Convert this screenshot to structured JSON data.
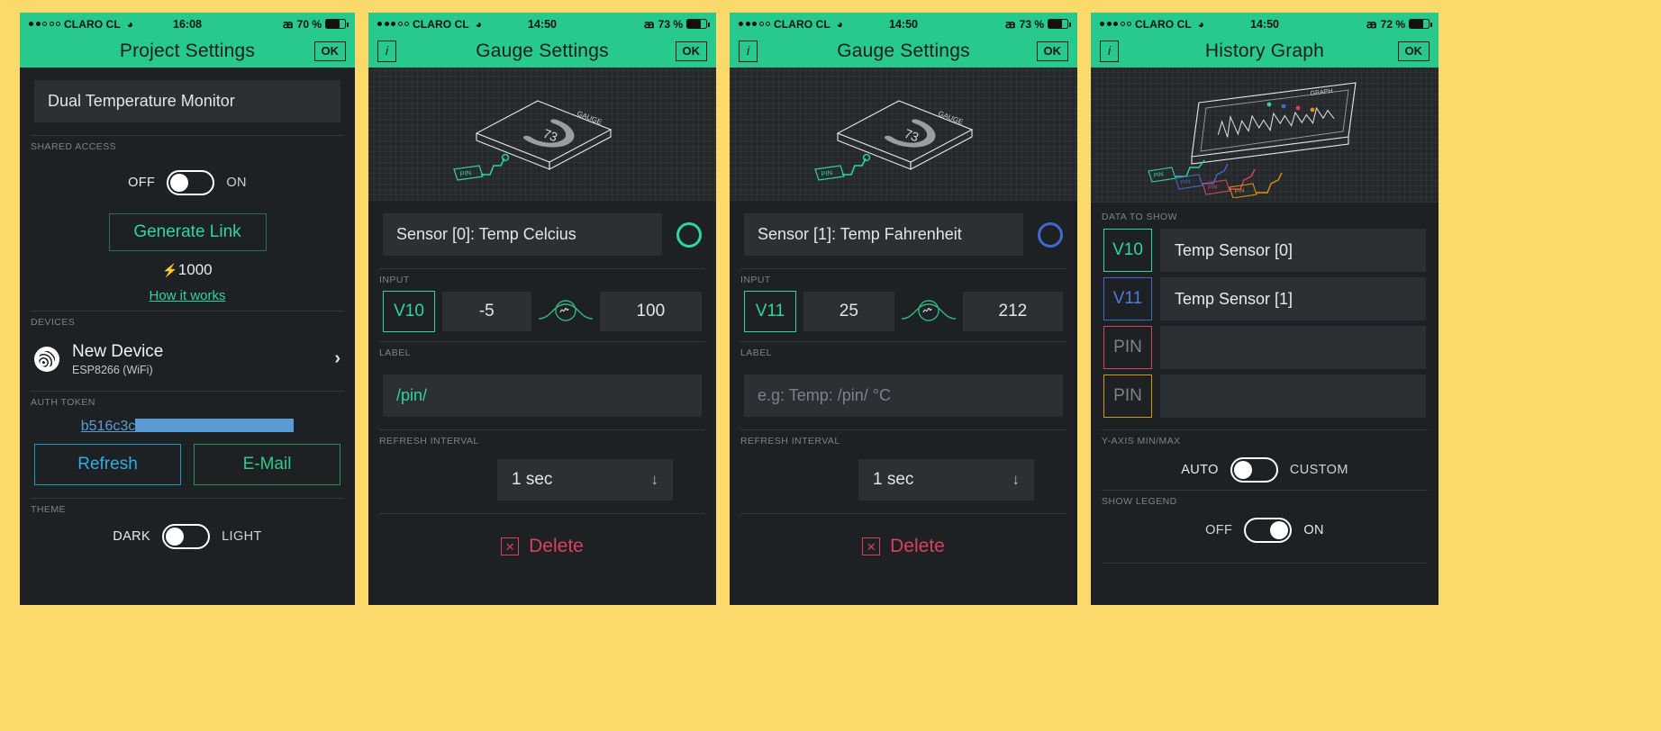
{
  "theme": {
    "accent_green": "#27C98C",
    "page_bg": "#FBD96B",
    "panel_bg": "#1E2124",
    "field_bg": "#2C2F33",
    "blue": "#4169C9",
    "red": "#D8415E",
    "amber": "#D99212",
    "link_blue": "#5B9BD5"
  },
  "panels": [
    {
      "id": "project-settings",
      "status": {
        "carrier": "CLARO CL",
        "signal_filled": 2,
        "signal_total": 5,
        "wifi": "wifi-icon",
        "time": "16:08",
        "bluetooth": "bluetooth-icon",
        "battery_text": "70 %",
        "battery_pct": 70
      },
      "nav": {
        "title": "Project Settings",
        "right_button": "OK",
        "left_button": null
      },
      "project_name": "Dual Temperature Monitor",
      "shared_access": {
        "label": "SHARED ACCESS",
        "off_label": "OFF",
        "on_label": "ON",
        "state": "off",
        "generate_link": "Generate Link",
        "energy": "1000",
        "energy_icon": "bolt-icon",
        "how_it_works": "How it works"
      },
      "devices": {
        "label": "DEVICES",
        "items": [
          {
            "name": "New Device",
            "sub": "ESP8266 (WiFi)",
            "icon": "device-wifi-icon",
            "chevron": "chevron-right-icon"
          }
        ]
      },
      "auth": {
        "label": "AUTH TOKEN",
        "token_visible": "b516c3c",
        "token_redacted": true,
        "refresh": "Refresh",
        "email": "E-Mail"
      },
      "theme_row": {
        "label": "THEME",
        "left": "DARK",
        "right": "LIGHT",
        "state": "dark"
      }
    },
    {
      "id": "gauge-settings-celcius",
      "status": {
        "carrier": "CLARO CL",
        "signal_filled": 3,
        "signal_total": 5,
        "wifi": "wifi-icon",
        "time": "14:50",
        "bluetooth": "bluetooth-icon",
        "battery_text": "73 %",
        "battery_pct": 73
      },
      "nav": {
        "title": "Gauge Settings",
        "right_button": "OK",
        "left_button": "i"
      },
      "hero": {
        "widget_label": "GAUGE",
        "gauge_value": "73",
        "pin_tag": "PIN"
      },
      "name_field": "Sensor [0]: Temp Celcius",
      "indicator_color": "#2FD69B",
      "input": {
        "label": "INPUT",
        "pin": "V10",
        "min": "-5",
        "max": "100",
        "link_icon": "squiggle-link-icon"
      },
      "label_field": {
        "label": "LABEL",
        "value": "/pin/",
        "placeholder": "e.g: Temp: /pin/ °C"
      },
      "refresh": {
        "label": "REFRESH INTERVAL",
        "value": "1 sec",
        "arrow": "arrow-down-icon"
      },
      "delete": {
        "text": "Delete",
        "icon": "trash-icon"
      }
    },
    {
      "id": "gauge-settings-fahrenheit",
      "status": {
        "carrier": "CLARO CL",
        "signal_filled": 3,
        "signal_total": 5,
        "wifi": "wifi-icon",
        "time": "14:50",
        "bluetooth": "bluetooth-icon",
        "battery_text": "73 %",
        "battery_pct": 73
      },
      "nav": {
        "title": "Gauge Settings",
        "right_button": "OK",
        "left_button": "i"
      },
      "hero": {
        "widget_label": "GAUGE",
        "gauge_value": "73",
        "pin_tag": "PIN"
      },
      "name_field": "Sensor [1]: Temp Fahrenheit",
      "indicator_color": "#4169C9",
      "input": {
        "label": "INPUT",
        "pin": "V11",
        "min": "25",
        "max": "212",
        "link_icon": "squiggle-link-icon"
      },
      "label_field": {
        "label": "LABEL",
        "value": "",
        "placeholder": "e.g: Temp: /pin/ °C"
      },
      "refresh": {
        "label": "REFRESH INTERVAL",
        "value": "1 sec",
        "arrow": "arrow-down-icon"
      },
      "delete": {
        "text": "Delete",
        "icon": "trash-icon"
      }
    },
    {
      "id": "history-graph",
      "status": {
        "carrier": "CLARO CL",
        "signal_filled": 3,
        "signal_total": 5,
        "wifi": "wifi-icon",
        "time": "14:50",
        "bluetooth": "bluetooth-icon",
        "battery_text": "72 %",
        "battery_pct": 72
      },
      "nav": {
        "title": "History Graph",
        "right_button": "OK",
        "left_button": "i"
      },
      "hero": {
        "widget_label": "GRAPH",
        "pin_tags": [
          "PIN",
          "PIN",
          "PIN",
          "PIN"
        ]
      },
      "data_to_show": {
        "label": "DATA TO SHOW",
        "rows": [
          {
            "pin": "V10",
            "color": "#2FD69B",
            "value": "Temp Sensor [0]"
          },
          {
            "pin": "V11",
            "color": "#4169C9",
            "value": "Temp Sensor [1]"
          },
          {
            "pin": "PIN",
            "color": "#D8415E",
            "value": ""
          },
          {
            "pin": "PIN",
            "color": "#D99212",
            "value": ""
          }
        ]
      },
      "y_axis": {
        "label": "Y-AXIS MIN/MAX",
        "left": "AUTO",
        "right": "CUSTOM",
        "state": "auto"
      },
      "legend": {
        "label": "SHOW LEGEND",
        "left": "OFF",
        "right": "ON",
        "state": "on"
      }
    }
  ]
}
